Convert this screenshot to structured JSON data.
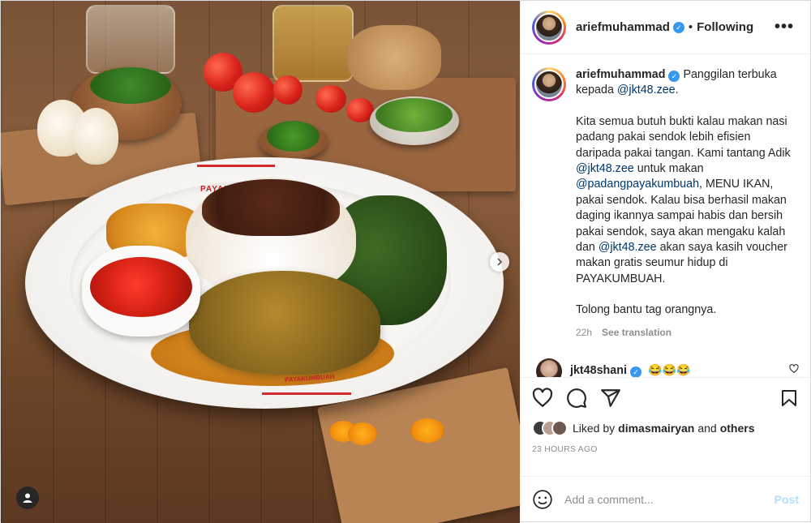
{
  "post": {
    "username": "ariefmuhammad",
    "separator": "•",
    "follow_status": "Following",
    "more_label": "•••"
  },
  "caption": {
    "username": "ariefmuhammad",
    "line1": "Panggilan terbuka kepada",
    "mention1": "@jkt48.zee",
    "line1_end": ".",
    "p2_a": "Kita semua butuh bukti kalau makan nasi padang pakai sendok lebih efisien daripada pakai tangan. Kami tantang Adik",
    "mention2": "@jkt48.zee",
    "p2_b": "untuk makan",
    "mention3": "@padangpayakumbuah",
    "p2_c": ", MENU IKAN, pakai sendok. Kalau bisa berhasil makan daging ikannya sampai habis dan bersih pakai sendok, saya akan mengaku kalah dan",
    "mention4": "@jkt48.zee",
    "p2_d": "akan saya kasih voucher makan gratis seumur hidup di PAYAKUMBUAH.",
    "p3": "Tolong bantu tag orangnya.",
    "time": "22h",
    "translate": "See translation"
  },
  "comments": [
    {
      "username": "jkt48shani",
      "text": "😂😂😂"
    }
  ],
  "photo": {
    "logo_top": "PAYAKUMBUAH",
    "logo_bottom": "PAYAKUMBUAH"
  },
  "likes": {
    "prefix": "Liked by",
    "user": "dimasmairyan",
    "joiner": "and",
    "others": "others"
  },
  "timestamp": "23 HOURS AGO",
  "add_comment": {
    "placeholder": "Add a comment...",
    "post_label": "Post"
  },
  "colors": {
    "verified": "#3897f0",
    "mention": "#00376b",
    "post_button": "#b2dffc"
  },
  "icons": [
    "heart-icon",
    "comment-icon",
    "share-icon",
    "bookmark-icon",
    "emoji-icon",
    "next-icon",
    "user-tag-icon",
    "verified-icon"
  ]
}
